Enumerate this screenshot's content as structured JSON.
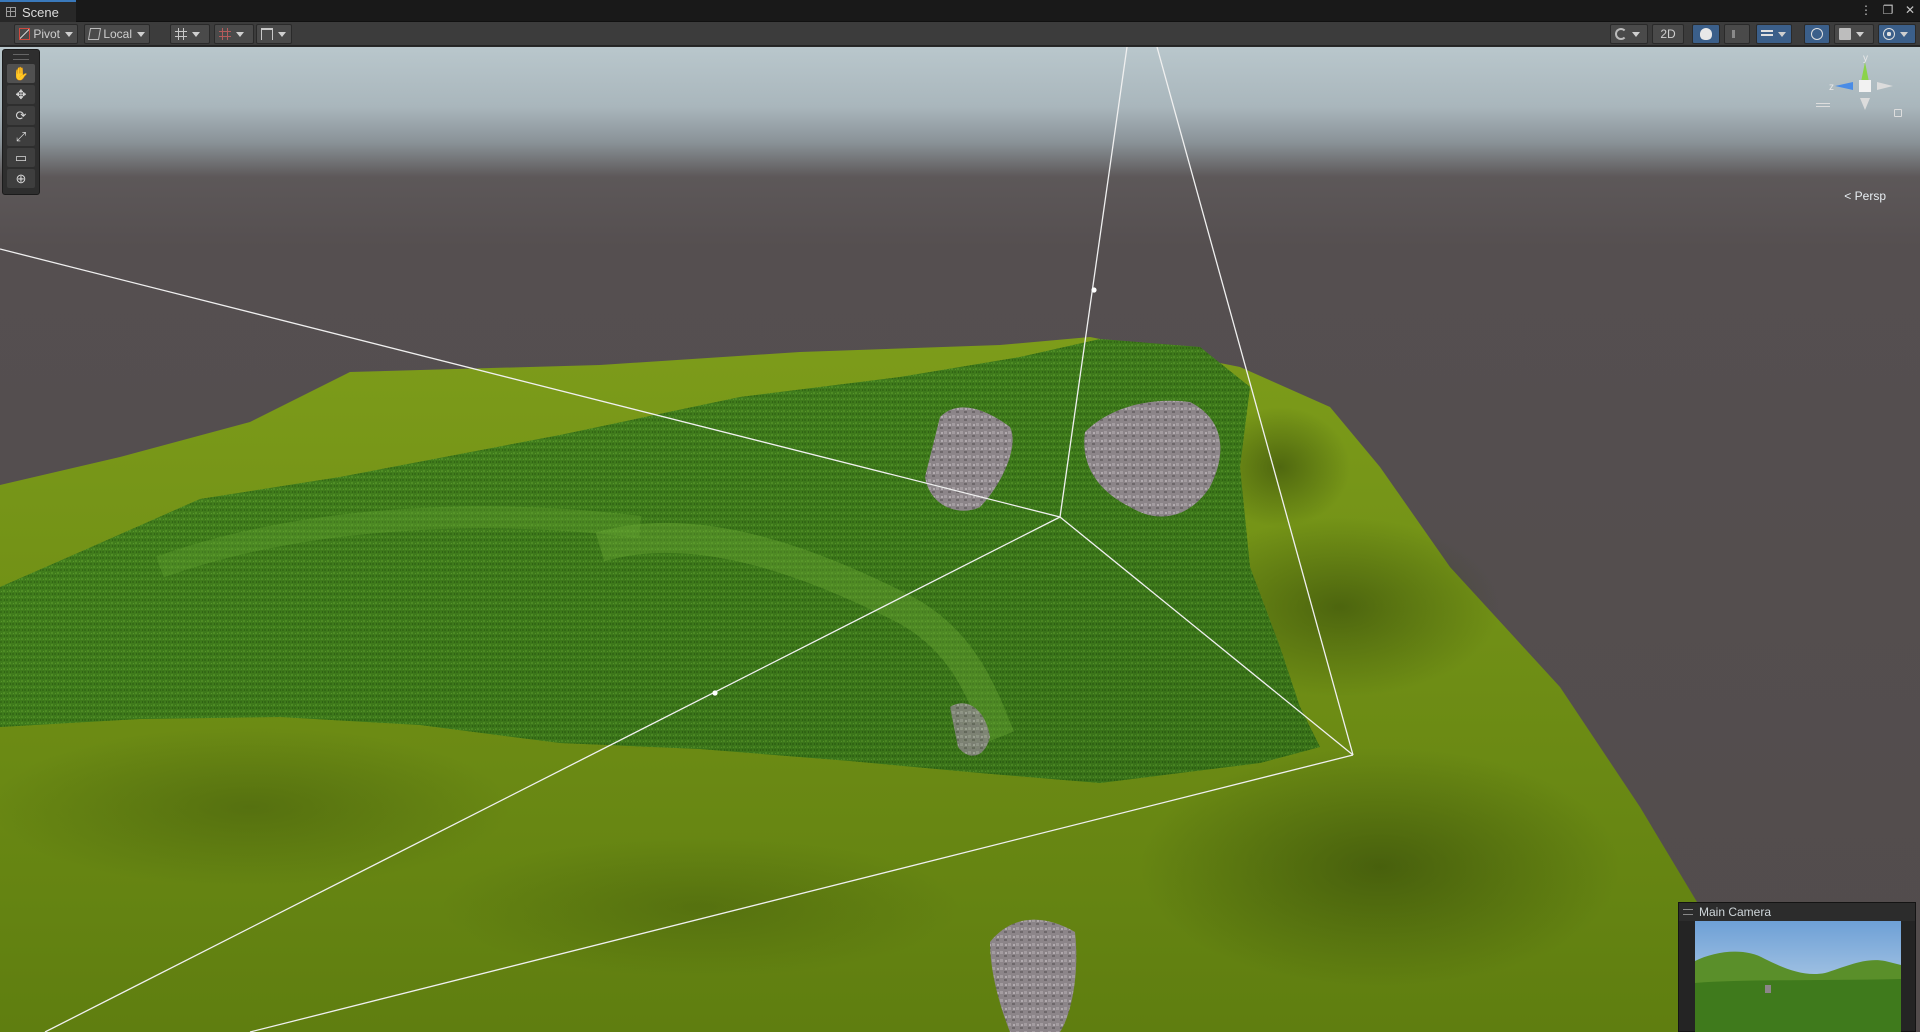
{
  "tab": {
    "title": "Scene",
    "icon": "grid-icon"
  },
  "window_controls": [
    "⋮",
    "❐",
    "✕"
  ],
  "toolbar": {
    "pivot_label": "Pivot",
    "local_label": "Local",
    "twod_label": "2D"
  },
  "tools": [
    {
      "name": "hand-tool",
      "glyph": "✋"
    },
    {
      "name": "move-tool",
      "glyph": "✥"
    },
    {
      "name": "rotate-tool",
      "glyph": "⟳"
    },
    {
      "name": "scale-tool",
      "glyph": "⤢"
    },
    {
      "name": "rect-tool",
      "glyph": "▭"
    },
    {
      "name": "transform-tool",
      "glyph": "⊕"
    }
  ],
  "gizmo": {
    "y_axis": "y",
    "z_axis": "z",
    "projection": "Persp",
    "back_arrow": "<"
  },
  "camera_preview": {
    "title": "Main Camera"
  },
  "colors": {
    "sky_top": "#b9c7cc",
    "ground_far": "#524c4c",
    "terrain_light": "#6f8c16",
    "terrain_dark": "#4b6a0c",
    "grass": "#3f7a1c",
    "rock": "#8a8487",
    "frustum": "#f0f0f0",
    "axis_x": "#e0513c",
    "axis_y": "#8bd34a",
    "axis_z": "#4a8ce6"
  }
}
